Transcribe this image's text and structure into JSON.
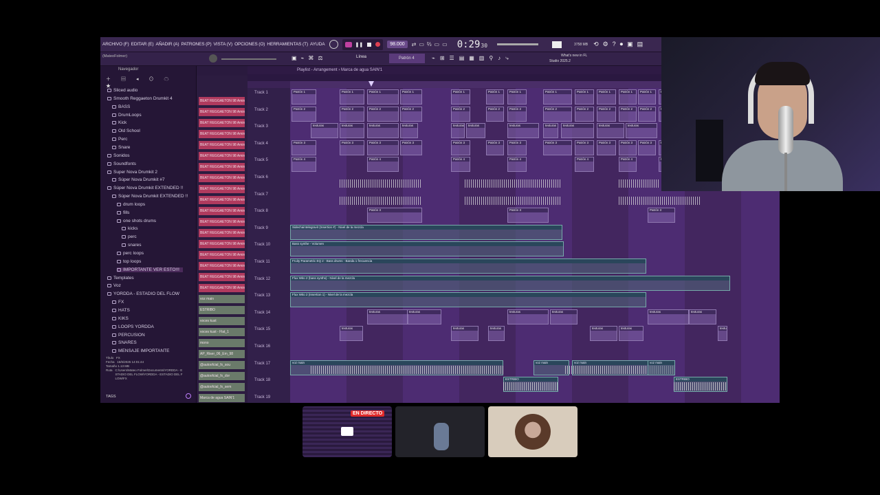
{
  "menu": {
    "items": [
      "ARCHIVO (F)",
      "EDITAR (E)",
      "AÑADIR (A)",
      "PATRONES (P)",
      "VISTA (V)",
      "OPCIONES (O)",
      "HERRAMIENTAS (T)",
      "AYUDA"
    ],
    "bpm": "98.000",
    "time": "0:29",
    "time_sub": "30",
    "memory": "3758 MB",
    "news_line1": "What's new in FL",
    "news_line2": "Studio 2025.2"
  },
  "toolbar": {
    "project_name": "(MateoFolmer)",
    "snap": "Línea",
    "pattern": "Patrón 4"
  },
  "browser": {
    "header": "Navegador",
    "items": [
      {
        "label": "Sliced audio",
        "indent": 0
      },
      {
        "label": "Smooth Reggaeton Drumkit 4",
        "indent": 0
      },
      {
        "label": "BASS",
        "indent": 1
      },
      {
        "label": "DrumLoops",
        "indent": 1
      },
      {
        "label": "Kick",
        "indent": 1
      },
      {
        "label": "Old School",
        "indent": 1
      },
      {
        "label": "Perc",
        "indent": 1
      },
      {
        "label": "Snare",
        "indent": 1
      },
      {
        "label": "Sonidos",
        "indent": 0
      },
      {
        "label": "Soundfonts",
        "indent": 0
      },
      {
        "label": "Super Nova Drumkit 2",
        "indent": 0
      },
      {
        "label": "Súper Nova Drumkit #7",
        "indent": 1
      },
      {
        "label": "Súper Nova Drumkit EXTENDED !!",
        "indent": 0
      },
      {
        "label": "Súper Nova Drumkit EXTENDED !!",
        "indent": 1
      },
      {
        "label": "drum loops",
        "indent": 2
      },
      {
        "label": "fills",
        "indent": 2
      },
      {
        "label": "one shots drums",
        "indent": 2
      },
      {
        "label": "kicks",
        "indent": 3
      },
      {
        "label": "perc",
        "indent": 3
      },
      {
        "label": "snares",
        "indent": 3
      },
      {
        "label": "perc loops",
        "indent": 2
      },
      {
        "label": "top loops",
        "indent": 2
      },
      {
        "label": "IMPORTANTE VER ESTO!!!",
        "indent": 2
      },
      {
        "label": "Templates",
        "indent": 0
      },
      {
        "label": "Voz",
        "indent": 0
      },
      {
        "label": "YORDDA - ESTADIO DEL FLOW",
        "indent": 0
      },
      {
        "label": "FX",
        "indent": 1
      },
      {
        "label": "HATS",
        "indent": 1
      },
      {
        "label": "KIKS",
        "indent": 1
      },
      {
        "label": "LOOPS YORDDA",
        "indent": 1
      },
      {
        "label": "PERCUSION",
        "indent": 1
      },
      {
        "label": "SNARES",
        "indent": 1
      },
      {
        "label": "MENSAJE IMPORTANTE",
        "indent": 1
      }
    ],
    "info": {
      "titulo_label": "Título",
      "titulo": "FX",
      "fecha_label": "Fecha",
      "fecha": "16/6/2025 14:01:44",
      "tamano_label": "Tamaño",
      "tamano": "1.13 MB",
      "ruta_label": "Ruta",
      "ruta": "C:\\Users\\Mateo Folmer\\Documents\\YORDDA - ESTADIO DEL FLOW\\YORDDA - ESTADIO DEL FLOW\\FX"
    },
    "tags_label": "TAGS"
  },
  "rack": {
    "channels": [
      "BEAT REGGAETON 98 Amin",
      "BEAT REGGAETON 98 Amin",
      "BEAT REGGAETON 98 Amin",
      "BEAT REGGAETON 98 Amin",
      "BEAT REGGAETON 98 Amin",
      "BEAT REGGAETON 98 Amin",
      "BEAT REGGAETON 98 Amin",
      "BEAT REGGAETON 98 Amin",
      "BEAT REGGAETON 98 Amin",
      "BEAT REGGAETON 98 Amin",
      "BEAT REGGAETON 98 Amin",
      "BEAT REGGAETON 98 Amin",
      "BEAT REGGAETON 98 Amin",
      "BEAT REGGAETON 98 Amin",
      "BEAT REGGAETON 98 Amin",
      "BEAT REGGAETON 98 Amin",
      "BEAT REGGAETON 98 Amin",
      "BEAT REGGAETON 98 Amin",
      "voz main",
      "ESTRIBO",
      "voces kust",
      "voces kust - Flat_1",
      "mono",
      "AP_Riser_06_Em_98",
      "@autoofcial_fx_sou",
      "@autoofcial_fx_dor",
      "@autoofcial_fx_sem",
      "Marca de agua SAIN'1"
    ]
  },
  "playlist": {
    "title": "Playlist - Arrangement › Marca de agua SAIN'1",
    "tracks": [
      "Track 1",
      "Track 2",
      "Track 3",
      "Track 4",
      "Track 5",
      "Track 6",
      "Track 7",
      "Track 8",
      "Track 9",
      "Track 10",
      "Track 11",
      "Track 12",
      "Track 13",
      "Track 14",
      "Track 15",
      "Track 16",
      "Track 17",
      "Track 18",
      "Track 19"
    ],
    "clip_labels": {
      "t9": "Sidechaintelegravit (Insertion #) - Nivel de la mezcla",
      "t10": "Bass synthe - Volumen",
      "t11": "Fruity Parametric EQ 2 - Bass drums - Banda 1 frecuencia",
      "t12": "Flux Wito 2 (bass synths) - Nivel de la mezcla",
      "t13": "Flux Wito 2 (Insertion 1) - Nivel de la mezcla",
      "t17a": "voz main",
      "t17b": "voz main",
      "t17c": "voz main",
      "t17d": "voz main",
      "t18": "ESTRIBO",
      "p1": "Patrón 1",
      "p2": "Patrón 2",
      "p3": "Patrón 3",
      "p4": "Patrón 4",
      "tx": "texturas"
    }
  },
  "call": {
    "live_badge": "EN DIRECTO"
  }
}
